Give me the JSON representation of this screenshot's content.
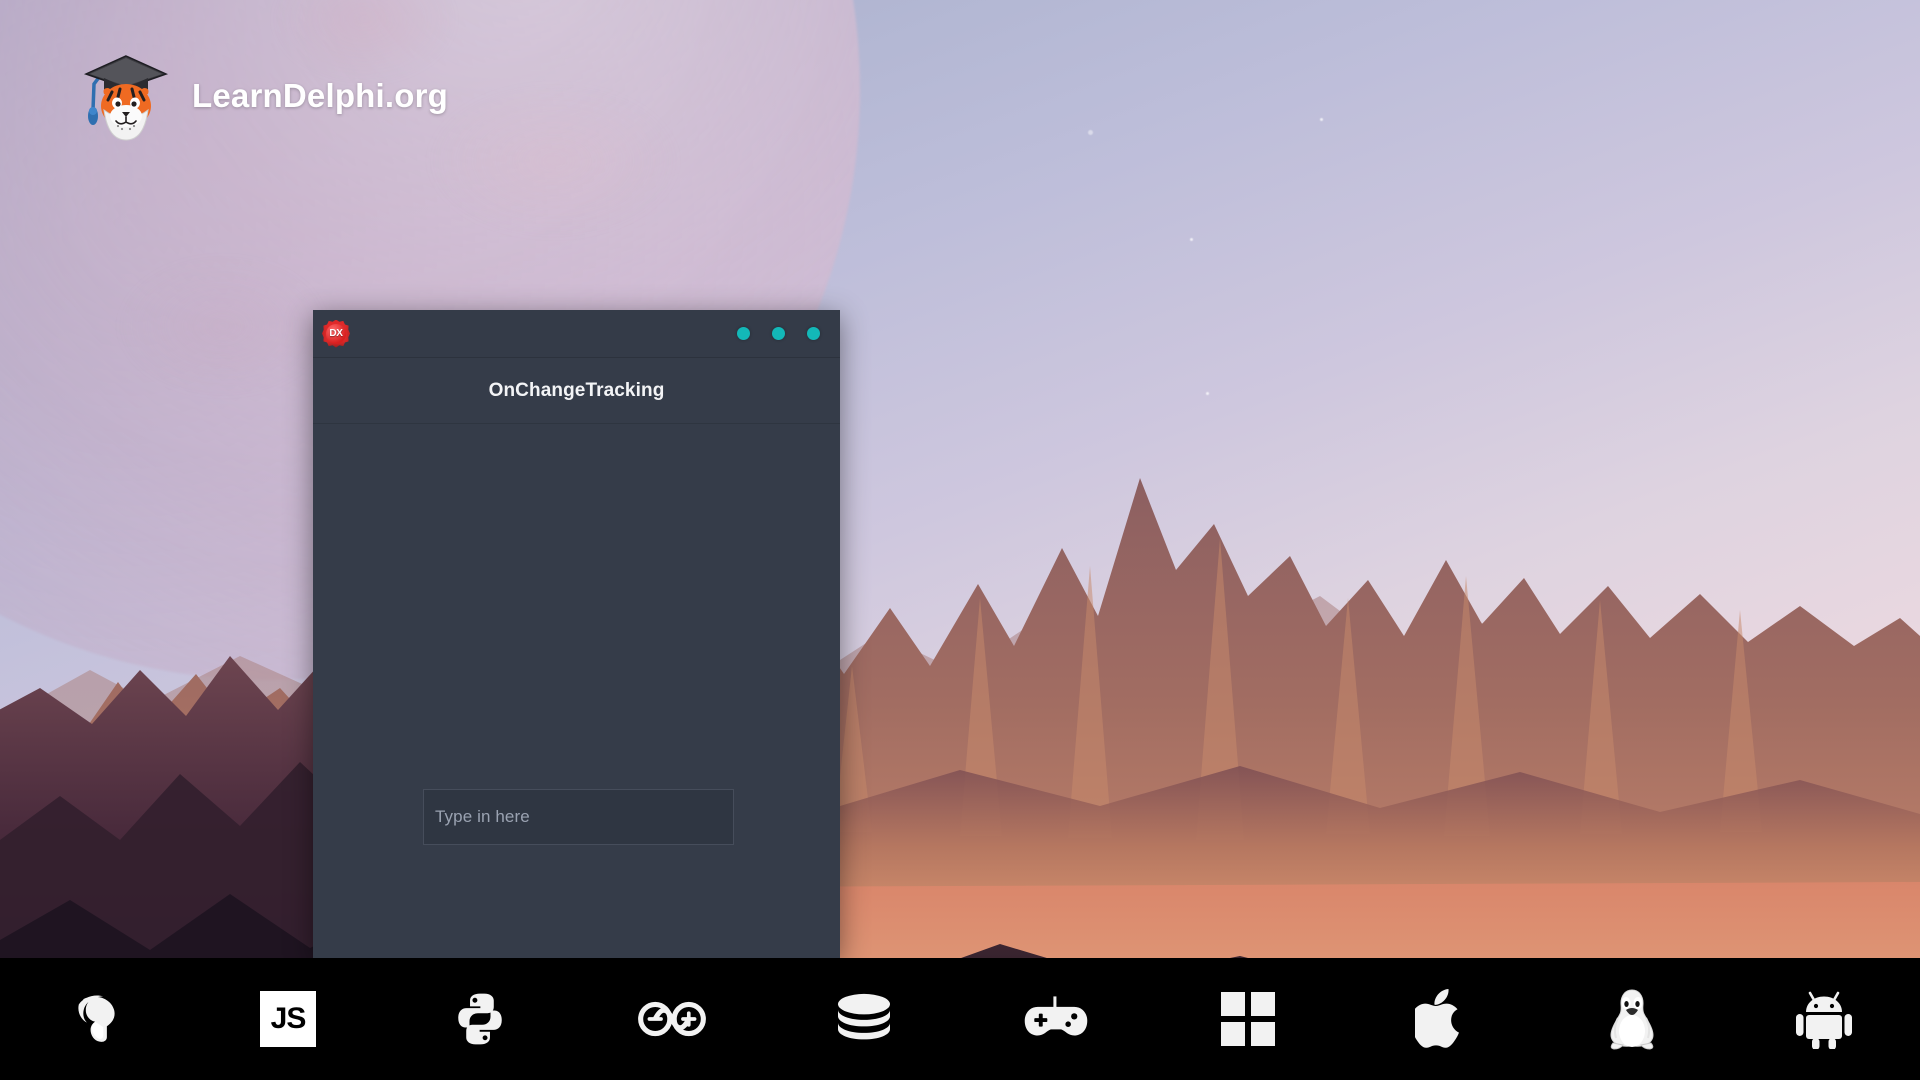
{
  "brand": {
    "name": "LearnDelphi.org",
    "logo_icon": "tiger-graduate-icon"
  },
  "desktop": {
    "wallpaper_description": "alien-mars-landscape-with-planet",
    "sky_color_top": "#9fa9c9",
    "sky_color_bottom": "#f2dcdd",
    "planet_color": "#e0bcc9",
    "mountain_color": "#8a5a58",
    "plain_color": "#dc8a6e",
    "foreground_color": "#2a1a28"
  },
  "window": {
    "app_icon": "dx-badge-icon",
    "app_icon_label": "DX",
    "title": "OnChangeTracking",
    "controls": [
      {
        "name": "minimize",
        "icon": "dot-icon",
        "color": "#13b8b8"
      },
      {
        "name": "maximize",
        "icon": "dot-icon",
        "color": "#13b8b8"
      },
      {
        "name": "close",
        "icon": "dot-icon",
        "color": "#13b8b8"
      }
    ],
    "input": {
      "placeholder": "Type in here",
      "value": ""
    },
    "background_color": "#353c49",
    "titlebar_color": "#343b48"
  },
  "taskbar": {
    "background_color": "#000000",
    "items": [
      {
        "label": "Delphi",
        "icon": "spartan-helmet-icon"
      },
      {
        "label": "JavaScript",
        "icon": "js-icon",
        "text": "JS"
      },
      {
        "label": "Python",
        "icon": "python-icon"
      },
      {
        "label": "Arduino",
        "icon": "arduino-infinity-icon"
      },
      {
        "label": "Database",
        "icon": "database-icon"
      },
      {
        "label": "Games",
        "icon": "gamepad-icon"
      },
      {
        "label": "Windows",
        "icon": "windows-icon"
      },
      {
        "label": "macOS",
        "icon": "apple-icon"
      },
      {
        "label": "Linux",
        "icon": "tux-penguin-icon"
      },
      {
        "label": "Android",
        "icon": "android-icon"
      }
    ]
  }
}
